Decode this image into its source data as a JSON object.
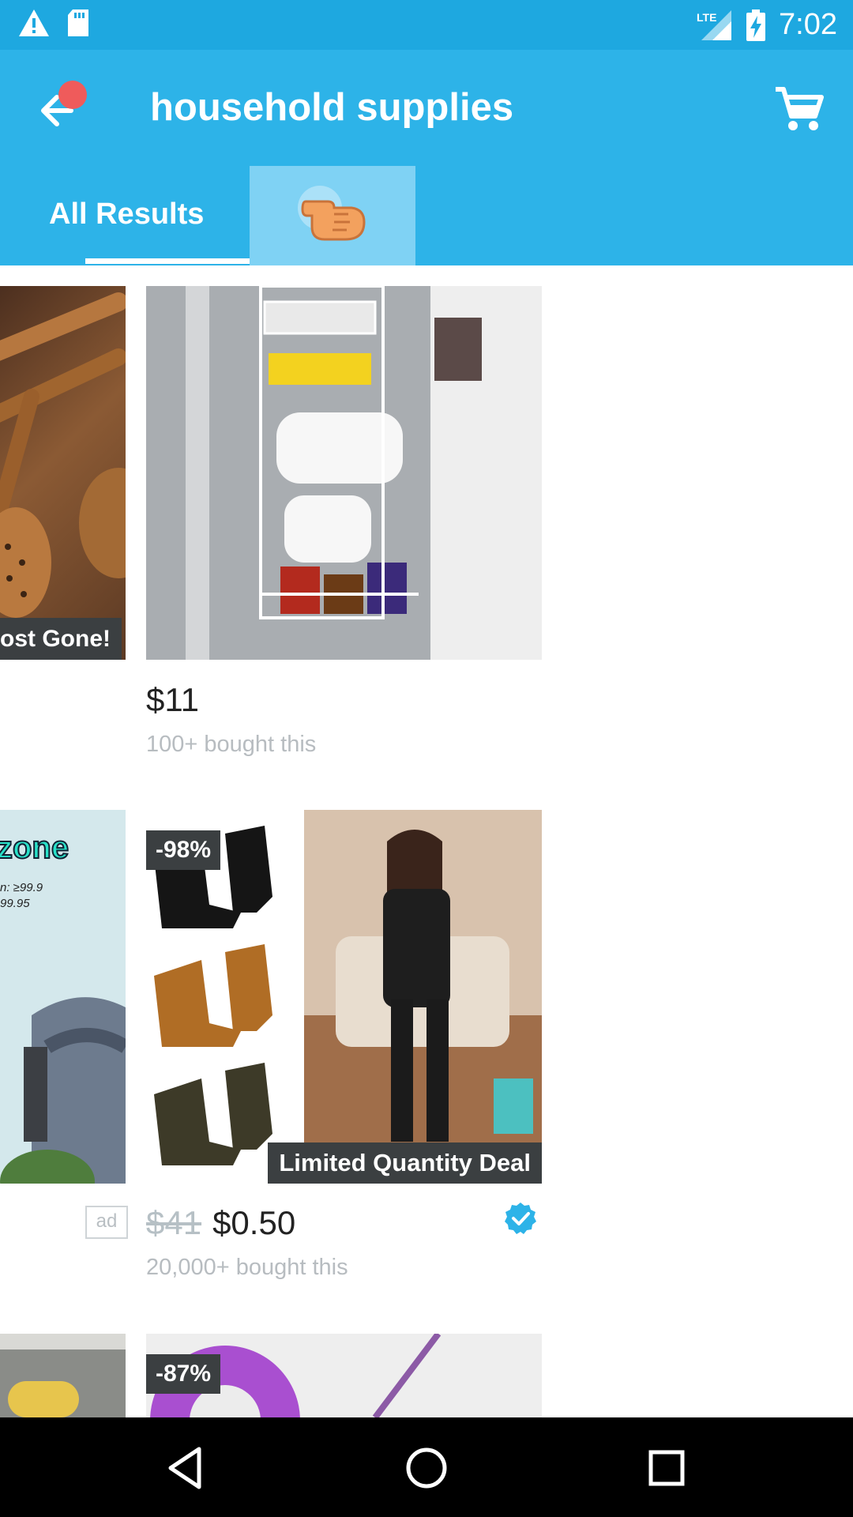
{
  "status_bar": {
    "time": "7:02",
    "network": "LTE",
    "icons": [
      "alert-icon",
      "sd-card-icon",
      "signal-icon",
      "battery-charging-icon"
    ]
  },
  "header": {
    "title": "household supplies",
    "back_icon": "arrow-left-icon",
    "cart_icon": "cart-icon"
  },
  "tabs": [
    {
      "label": "All Results"
    },
    {
      "label": "",
      "icon": "pointing-hand-icon"
    }
  ],
  "products": [
    {
      "badge": "ost Gone!"
    },
    {
      "price": "$11",
      "sold": "100+ bought this"
    },
    {
      "promo_text": "zone",
      "promo_line1": "n: ≥99.9",
      "promo_line2": "99.95",
      "ad_label": "ad"
    },
    {
      "discount": "-98%",
      "tag": "Limited Quantity Deal",
      "old_price": "$41",
      "price": "$0.50",
      "sold": "20,000+ bought this"
    },
    {
      "discount": "-87%"
    }
  ],
  "colors": {
    "status_bar": "#1ea8e0",
    "app_bar": "#2db3e8",
    "tab_highlight": "#7fd2f4",
    "badge": "#3b3f41",
    "notification_dot": "#ef5b5b",
    "verified": "#2db3e8"
  },
  "nav": {
    "back": "nav-back-icon",
    "home": "nav-home-icon",
    "recents": "nav-recents-icon"
  }
}
